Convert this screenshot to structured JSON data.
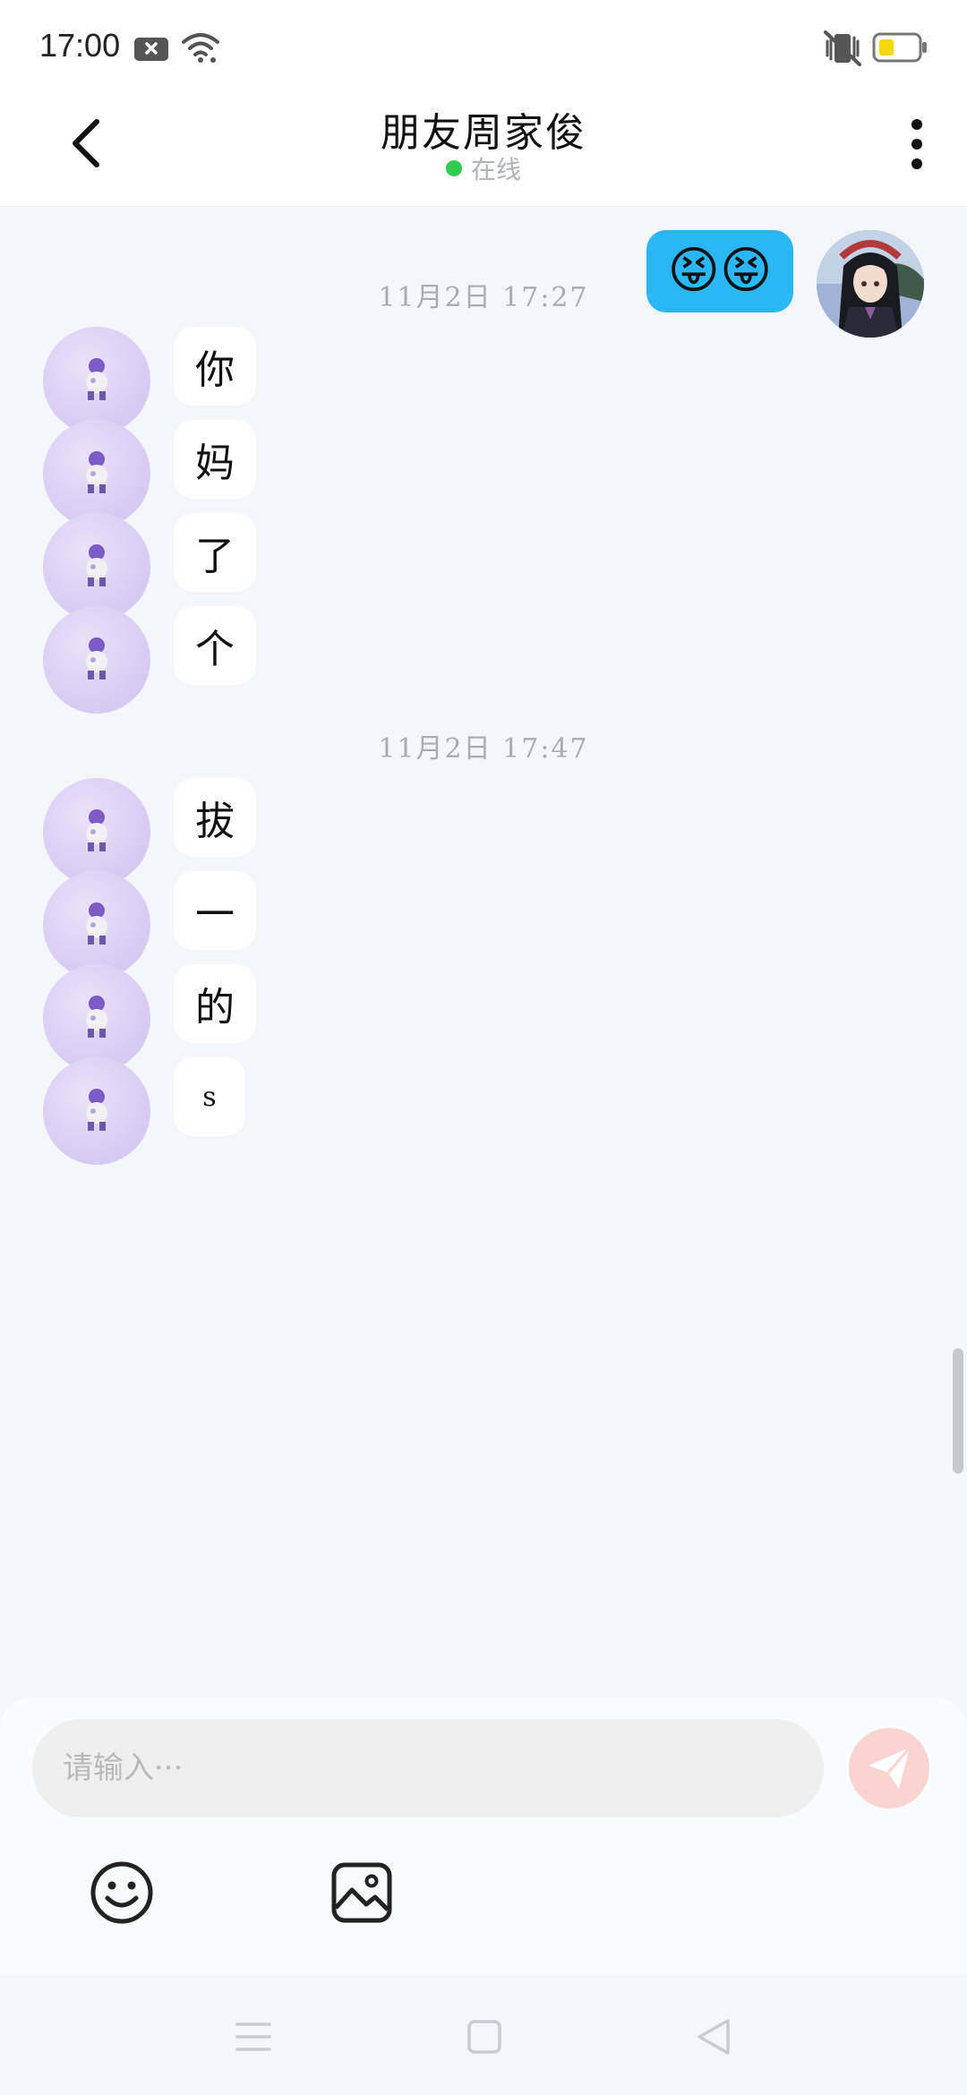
{
  "status_bar": {
    "time": "17:00",
    "icons": [
      "notification-x-icon",
      "wifi-icon",
      "vibrate-icon",
      "battery-icon"
    ],
    "battery_color": "#f5d90a"
  },
  "header": {
    "title": "朋友周家俊",
    "status": "在线",
    "status_color": "#2fca52",
    "back_icon": "chevron-left-icon",
    "more_icon": "more-vertical-icon"
  },
  "messages": {
    "sent": {
      "text": "😝😝",
      "bubble_color": "#2bb6f6"
    },
    "group1": {
      "timestamp": "11月2日 17:27",
      "items": [
        "你",
        "妈",
        "了",
        "个"
      ]
    },
    "group2": {
      "timestamp": "11月2日 17:47",
      "items": [
        "拔",
        "一",
        "的",
        "s"
      ]
    }
  },
  "composer": {
    "placeholder": "请输入···",
    "send_icon": "send-icon",
    "tools": [
      "emoji-icon",
      "image-icon"
    ]
  },
  "nav": [
    "menu-icon",
    "home-icon",
    "back-icon"
  ]
}
